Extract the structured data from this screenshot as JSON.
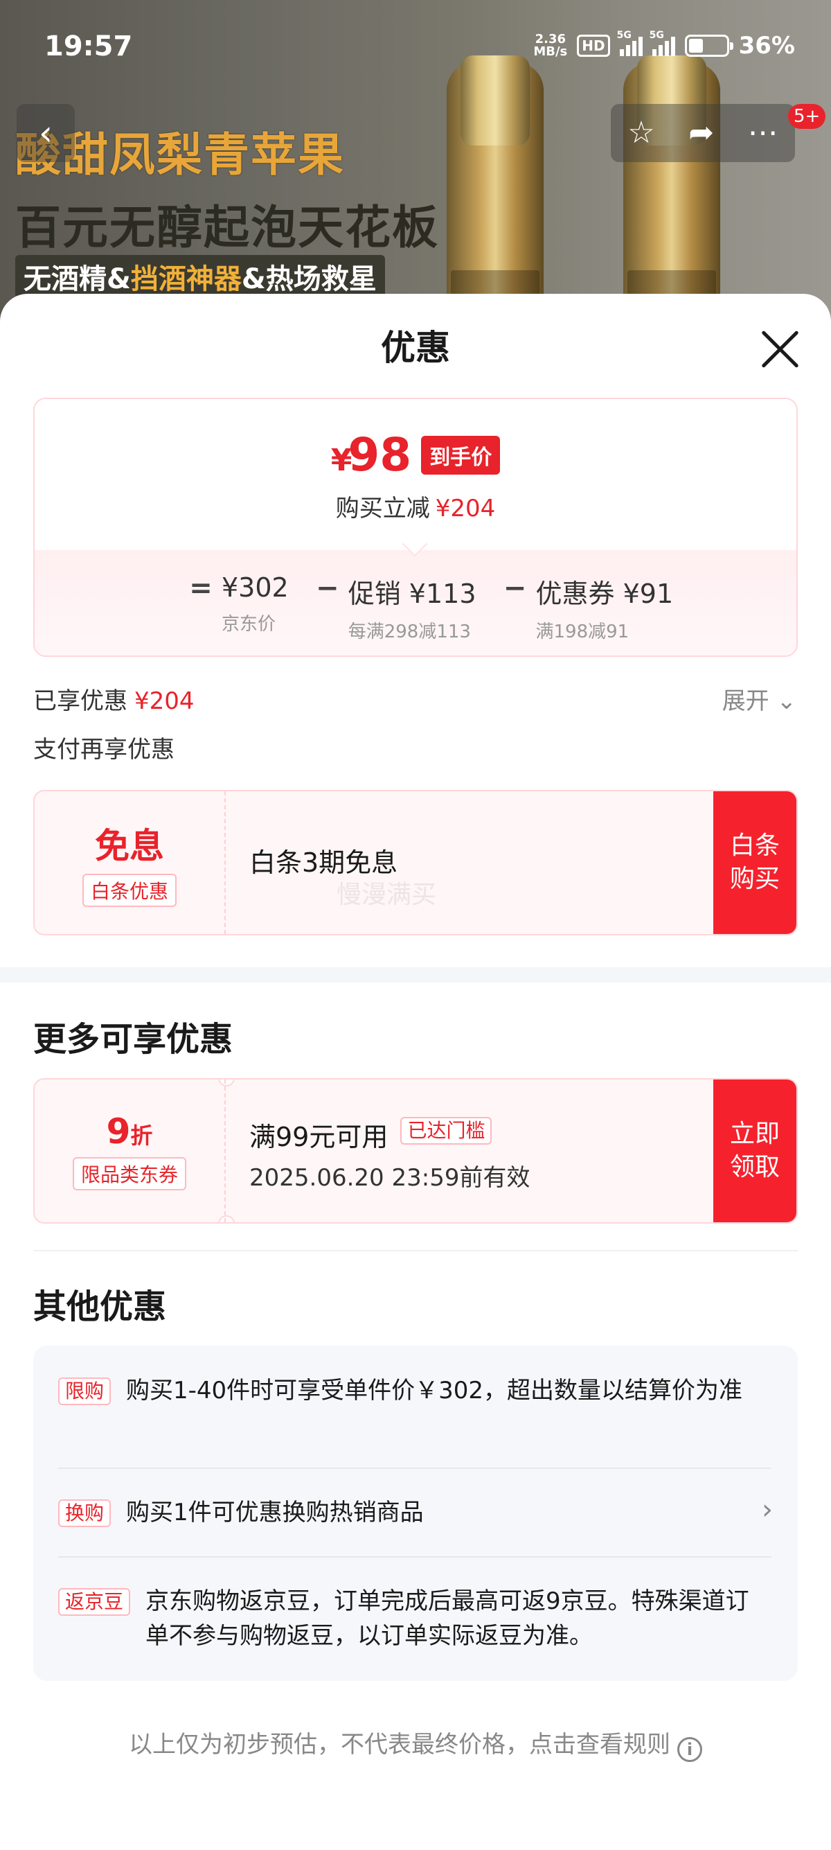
{
  "status_bar": {
    "time": "19:57",
    "net_speed_value": "2.36",
    "net_speed_unit": "MB/s",
    "hd_label": "HD",
    "signal1_label": "5G",
    "signal2_label": "5G",
    "battery_pct": "36%"
  },
  "banner": {
    "line1": "酸甜凤梨青苹果",
    "line2": "百元无醇起泡天花板",
    "line3_a": "无酒精&",
    "line3_b": "挡酒神器",
    "line3_c": "&热场救星"
  },
  "nav": {
    "badge": "5+"
  },
  "sheet": {
    "title": "优惠"
  },
  "price": {
    "currency": "¥",
    "final_value": "98",
    "final_tag": "到手价",
    "reduce_label": "购买立减",
    "reduce_amount": "¥204",
    "eq": "=",
    "minus": "−",
    "jd_price": "¥302",
    "jd_price_sub": "京东价",
    "promo": "促销 ¥113",
    "promo_sub": "每满298减113",
    "coupon": "优惠券 ¥91",
    "coupon_sub": "满198减91"
  },
  "enjoyed": {
    "label": "已享优惠",
    "amount": "¥204",
    "expand": "展开"
  },
  "pay_more": "支付再享优惠",
  "baitiao": {
    "big": "免息",
    "tag": "白条优惠",
    "desc": "白条3期免息",
    "button_line1": "白条",
    "button_line2": "购买",
    "watermark": "慢漫满买"
  },
  "more": {
    "title": "更多可享优惠",
    "discount_num": "9",
    "discount_unit": "折",
    "discount_tag": "限品类东券",
    "condition": "满99元可用",
    "status_tag": "已达门槛",
    "expiry": "2025.06.20 23:59前有效",
    "button_line1": "立即",
    "button_line2": "领取"
  },
  "other": {
    "title": "其他优惠",
    "rows": [
      {
        "tag": "限购",
        "text": "购买1-40件时可享受单件价￥302，超出数量以结算价为准"
      },
      {
        "tag": "换购",
        "text": "购买1件可优惠换购热销商品"
      },
      {
        "tag": "返京豆",
        "text": "京东购物返京豆，订单完成后最高可返9京豆。特殊渠道订单不参与购物返豆，以订单实际返豆为准。"
      }
    ]
  },
  "footer": {
    "text": "以上仅为初步预估，不代表最终价格，点击查看规则",
    "icon": "i"
  },
  "colors": {
    "accent": "#e8232b",
    "button_red": "#f5222d"
  }
}
